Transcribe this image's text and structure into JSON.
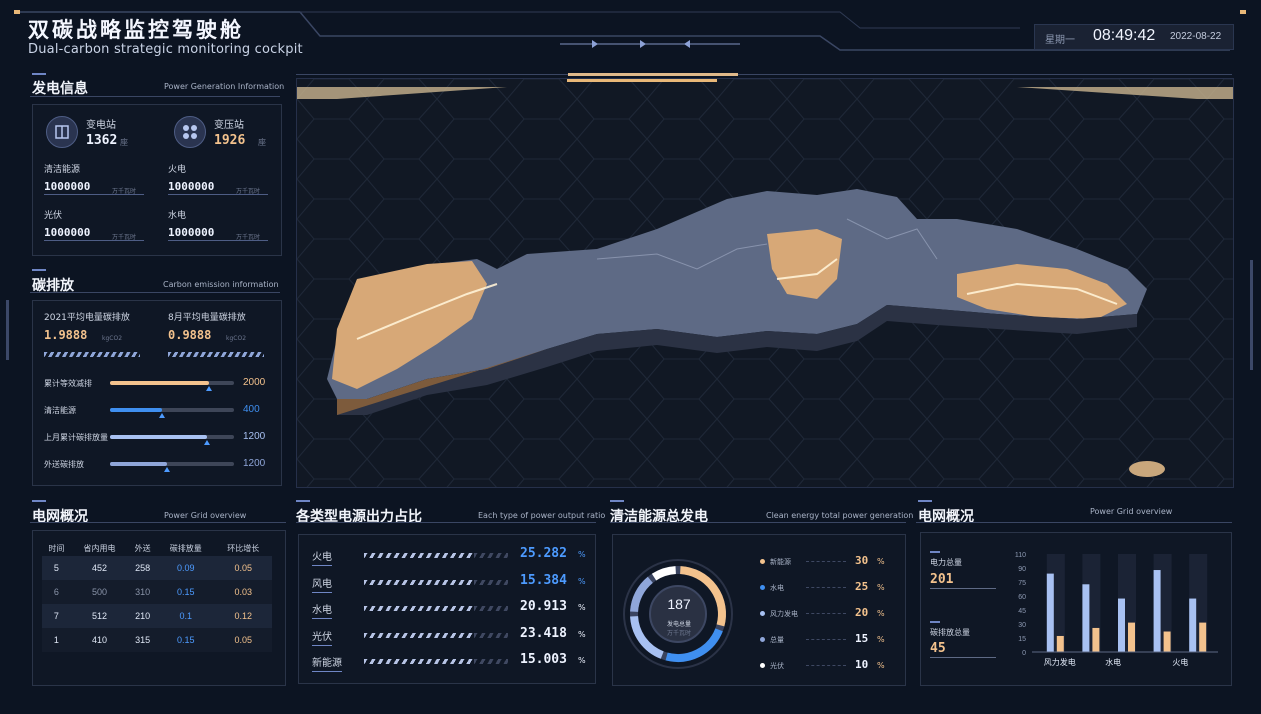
{
  "header": {
    "title_cn": "双碳战略监控驾驶舱",
    "title_en": "Dual-carbon strategic monitoring cockpit",
    "weekday": "星期一",
    "time": "08:49:42",
    "date": "2022-08-22"
  },
  "generation": {
    "title": "发电信息",
    "subtitle": "Power Generation Information",
    "substation": {
      "label": "变电站",
      "value": "1362",
      "unit": "座"
    },
    "transformer": {
      "label": "变压站",
      "value": "1926",
      "unit": "座"
    },
    "items": [
      {
        "label": "清洁能源",
        "value": "1000000",
        "unit": "万千瓦时"
      },
      {
        "label": "火电",
        "value": "1000000",
        "unit": "万千瓦时"
      },
      {
        "label": "光伏",
        "value": "1000000",
        "unit": "万千瓦时"
      },
      {
        "label": "水电",
        "value": "1000000",
        "unit": "万千瓦时"
      }
    ]
  },
  "carbon": {
    "title": "碳排放",
    "subtitle": "Carbon emission information",
    "year_label": "2021平均电量碳排放",
    "year_value": "1.9888",
    "year_unit": "kgCO2",
    "month_label": "8月平均电量碳排放",
    "month_value": "0.9888",
    "month_unit": "kgCO2",
    "bars": [
      {
        "label": "累计等效减排",
        "value": "2000",
        "fraction": 0.8,
        "color": "#f3c28d"
      },
      {
        "label": "清洁能源",
        "value": "400",
        "fraction": 0.42,
        "color": "#3f8ff0"
      },
      {
        "label": "上月累计碳排放量",
        "value": "1200",
        "fraction": 0.78,
        "color": "#a8c1f2"
      },
      {
        "label": "外送碳排放",
        "value": "1200",
        "fraction": 0.46,
        "color": "#8fa6d9"
      }
    ]
  },
  "grid_table": {
    "title": "电网概况",
    "subtitle": "Power Grid overview",
    "headers": [
      "时间",
      "省内用电",
      "外送",
      "碳排放量",
      "环比增长"
    ],
    "rows": [
      [
        "5",
        "452",
        "258",
        "0.09",
        "0.05"
      ],
      [
        "6",
        "500",
        "310",
        "0.15",
        "0.03"
      ],
      [
        "7",
        "512",
        "210",
        "0.1",
        "0.12"
      ],
      [
        "1",
        "410",
        "315",
        "0.15",
        "0.05"
      ]
    ]
  },
  "output_ratio": {
    "title": "各类型电源出力占比",
    "subtitle": "Each type of power output ratio",
    "unit": "%",
    "items": [
      {
        "label": "火电",
        "value": "25.282",
        "color": "#4d9bff"
      },
      {
        "label": "风电",
        "value": "15.384",
        "color": "#4d9bff"
      },
      {
        "label": "水电",
        "value": "20.913",
        "color": "#eef3ff"
      },
      {
        "label": "光伏",
        "value": "23.418",
        "color": "#eef3ff"
      },
      {
        "label": "新能源",
        "value": "15.003",
        "color": "#eef3ff"
      }
    ]
  },
  "clean_energy": {
    "title": "清洁能源总发电",
    "subtitle": "Clean energy total power generation",
    "center_value": "187",
    "center_label": "发电总量",
    "center_unit": "万千瓦时",
    "unit": "%",
    "legend": [
      {
        "label": "新能源",
        "value": "30",
        "color": "#f3c28d"
      },
      {
        "label": "水电",
        "value": "25",
        "color": "#3f8ff0"
      },
      {
        "label": "风力发电",
        "value": "20",
        "color": "#a8c1f2"
      },
      {
        "label": "总量",
        "value": "15",
        "color": "#8fa6d9"
      },
      {
        "label": "光伏",
        "value": "10",
        "color": "#ffffff"
      }
    ]
  },
  "grid_overview": {
    "title": "电网概况",
    "subtitle": "Power Grid overview",
    "power_label": "电力总量",
    "power_value": "201",
    "carbon_label": "碳排放总量",
    "carbon_value": "45"
  },
  "chart_data": {
    "type": "bar",
    "categories": [
      "风力发电",
      "水电",
      "火电"
    ],
    "series": [
      {
        "values": [
          88,
          76,
          60,
          92,
          60
        ]
      },
      {
        "values": [
          18,
          27,
          33,
          23,
          33
        ]
      }
    ],
    "ylim": [
      0,
      110
    ],
    "yticks": [
      "110",
      "90",
      "75",
      "60",
      "45",
      "30",
      "15",
      "0"
    ]
  }
}
